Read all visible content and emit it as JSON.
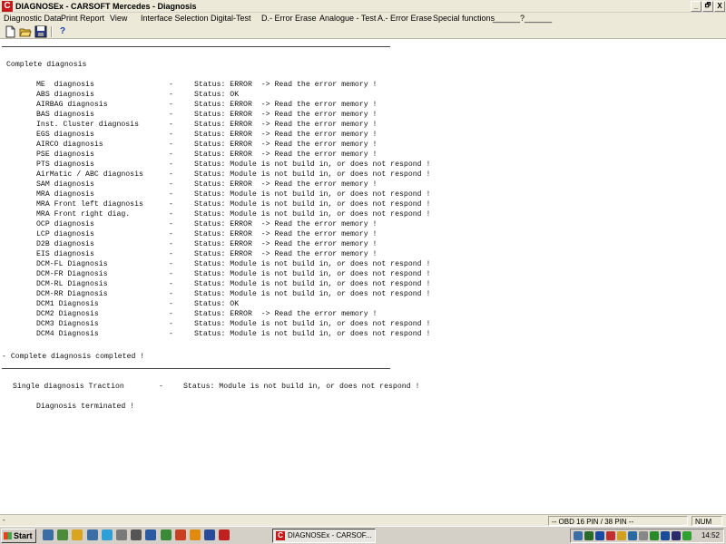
{
  "window": {
    "icon_letter": "C",
    "title": "DIAGNOSEx - CARSOFT Mercedes - Diagnosis",
    "minimize": "_",
    "maximize": "🗗",
    "close": "X"
  },
  "menu": [
    "Diagnostic Data",
    "Print Report",
    "View",
    "Interface Selection",
    "Digital-Test",
    "D.- Error Erase",
    "Analogue - Test",
    "A.- Error Erase",
    "Special functions",
    "______?______"
  ],
  "toolbar": {
    "icons": [
      "new-file-icon",
      "open-folder-icon",
      "save-disk-icon",
      "help-icon"
    ],
    "help_label": "?"
  },
  "document": {
    "heading": "Complete diagnosis",
    "rows": [
      {
        "module": "ME  diagnosis",
        "status": "Status: ERROR  -> Read the error memory !"
      },
      {
        "module": "ABS diagnosis",
        "status": "Status: OK"
      },
      {
        "module": "AIRBAG diagnosis",
        "status": "Status: ERROR  -> Read the error memory !"
      },
      {
        "module": "BAS diagnosis",
        "status": "Status: ERROR  -> Read the error memory !"
      },
      {
        "module": "Inst. Cluster diagnosis",
        "status": "Status: ERROR  -> Read the error memory !"
      },
      {
        "module": "EGS diagnosis",
        "status": "Status: ERROR  -> Read the error memory !"
      },
      {
        "module": "AIRCO diagnosis",
        "status": "Status: ERROR  -> Read the error memory !"
      },
      {
        "module": "PSE diagnosis",
        "status": "Status: ERROR  -> Read the error memory !"
      },
      {
        "module": "PTS diagnosis",
        "status": "Status: Module is not build in, or does not respond !"
      },
      {
        "module": "AirMatic / ABC diagnosis",
        "status": "Status: Module is not build in, or does not respond !"
      },
      {
        "module": "SAM diagnosis",
        "status": "Status: ERROR  -> Read the error memory !"
      },
      {
        "module": "MRA diagnosis",
        "status": "Status: Module is not build in, or does not respond !"
      },
      {
        "module": "MRA Front left diagnosis",
        "status": "Status: Module is not build in, or does not respond !"
      },
      {
        "module": "MRA Front right diag.",
        "status": "Status: Module is not build in, or does not respond !"
      },
      {
        "module": "OCP diagnosis",
        "status": "Status: ERROR  -> Read the error memory !"
      },
      {
        "module": "LCP diagnosis",
        "status": "Status: ERROR  -> Read the error memory !"
      },
      {
        "module": "D2B diagnosis",
        "status": "Status: ERROR  -> Read the error memory !"
      },
      {
        "module": "EIS diagnosis",
        "status": "Status: ERROR  -> Read the error memory !"
      },
      {
        "module": "DCM-FL Diagnosis",
        "status": "Status: Module is not build in, or does not respond !"
      },
      {
        "module": "DCM-FR Diagnosis",
        "status": "Status: Module is not build in, or does not respond !"
      },
      {
        "module": "DCM-RL Diagnosis",
        "status": "Status: Module is not build in, or does not respond !"
      },
      {
        "module": "DCM-RR Diagnosis",
        "status": "Status: Module is not build in, or does not respond !"
      },
      {
        "module": "DCM1 Diagnosis",
        "status": "Status: OK"
      },
      {
        "module": "DCM2 Diagnosis",
        "status": "Status: ERROR  -> Read the error memory !"
      },
      {
        "module": "DCM3 Diagnosis",
        "status": "Status: Module is not build in, or does not respond !"
      },
      {
        "module": "DCM4 Diagnosis",
        "status": "Status: Module is not build in, or does not respond !"
      }
    ],
    "separator": "-",
    "completed": "- Complete diagnosis completed !",
    "single": {
      "module": "Single diagnosis Traction",
      "separator": "-",
      "status": "Status: Module is not build in, or does not respond !"
    },
    "terminated": "Diagnosis terminated !"
  },
  "statusbar": {
    "left": "-",
    "connection": "-- OBD 16 PIN / 38 PIN  --",
    "num": "NUM"
  },
  "taskbar": {
    "start_label": "Start",
    "task_label": "DIAGNOSEx - CARSOF...",
    "task_icon_letter": "C",
    "clock": "14:52",
    "quicklaunch_colors": [
      "#3a6ea5",
      "#4a8c3a",
      "#d9a520",
      "#3a6ea5",
      "#2f9fd8",
      "#7a7a7a",
      "#555555",
      "#2a5aa0",
      "#3a8a3a",
      "#c84020",
      "#e08a10",
      "#2a4a9a",
      "#c02020"
    ],
    "tray_colors": [
      "#3a6ea5",
      "#2a6a2a",
      "#1a4aa0",
      "#c03030",
      "#d0a020",
      "#2a6aa0",
      "#888888",
      "#2a8a2a",
      "#1a4a9a",
      "#2a2a6a",
      "#30a030"
    ]
  }
}
